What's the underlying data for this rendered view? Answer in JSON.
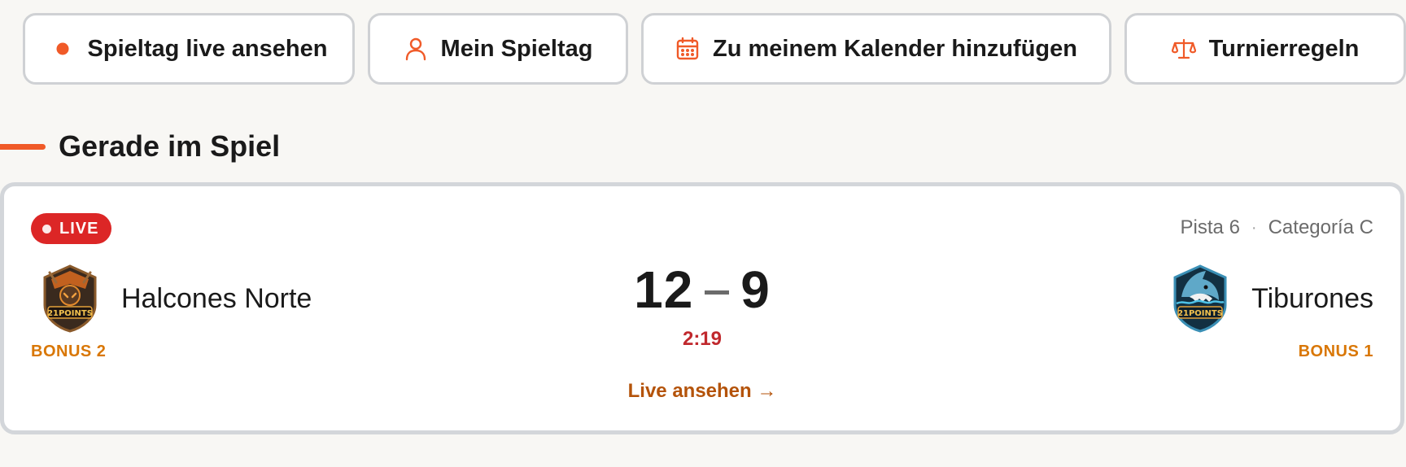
{
  "actions": {
    "live_label": "Spieltag live ansehen",
    "myday_label": "Mein Spieltag",
    "calendar_label": "Zu meinem Kalender hinzufügen",
    "rules_label": "Turnierregeln"
  },
  "section": {
    "title": "Gerade im Spiel"
  },
  "match": {
    "status": "LIVE",
    "court": "Pista 6",
    "separator": "·",
    "category": "Categoría C",
    "home": {
      "name": "Halcones Norte",
      "score": "12",
      "bonus": "BONUS 2",
      "logo_text": "21POINTS"
    },
    "away": {
      "name": "Tiburones",
      "score": "9",
      "bonus": "BONUS 1",
      "logo_text": "21POINTS"
    },
    "clock": "2:19",
    "watch_label": "Live ansehen →"
  },
  "colors": {
    "accent": "#f05a28",
    "live_red": "#dc2626",
    "bonus_amber": "#d97706",
    "clock_red": "#c0282d",
    "link_brown": "#b4530a"
  },
  "icons": {
    "live": "live-dot-icon",
    "myday": "user-icon",
    "calendar": "calendar-icon",
    "rules": "scales-icon"
  }
}
